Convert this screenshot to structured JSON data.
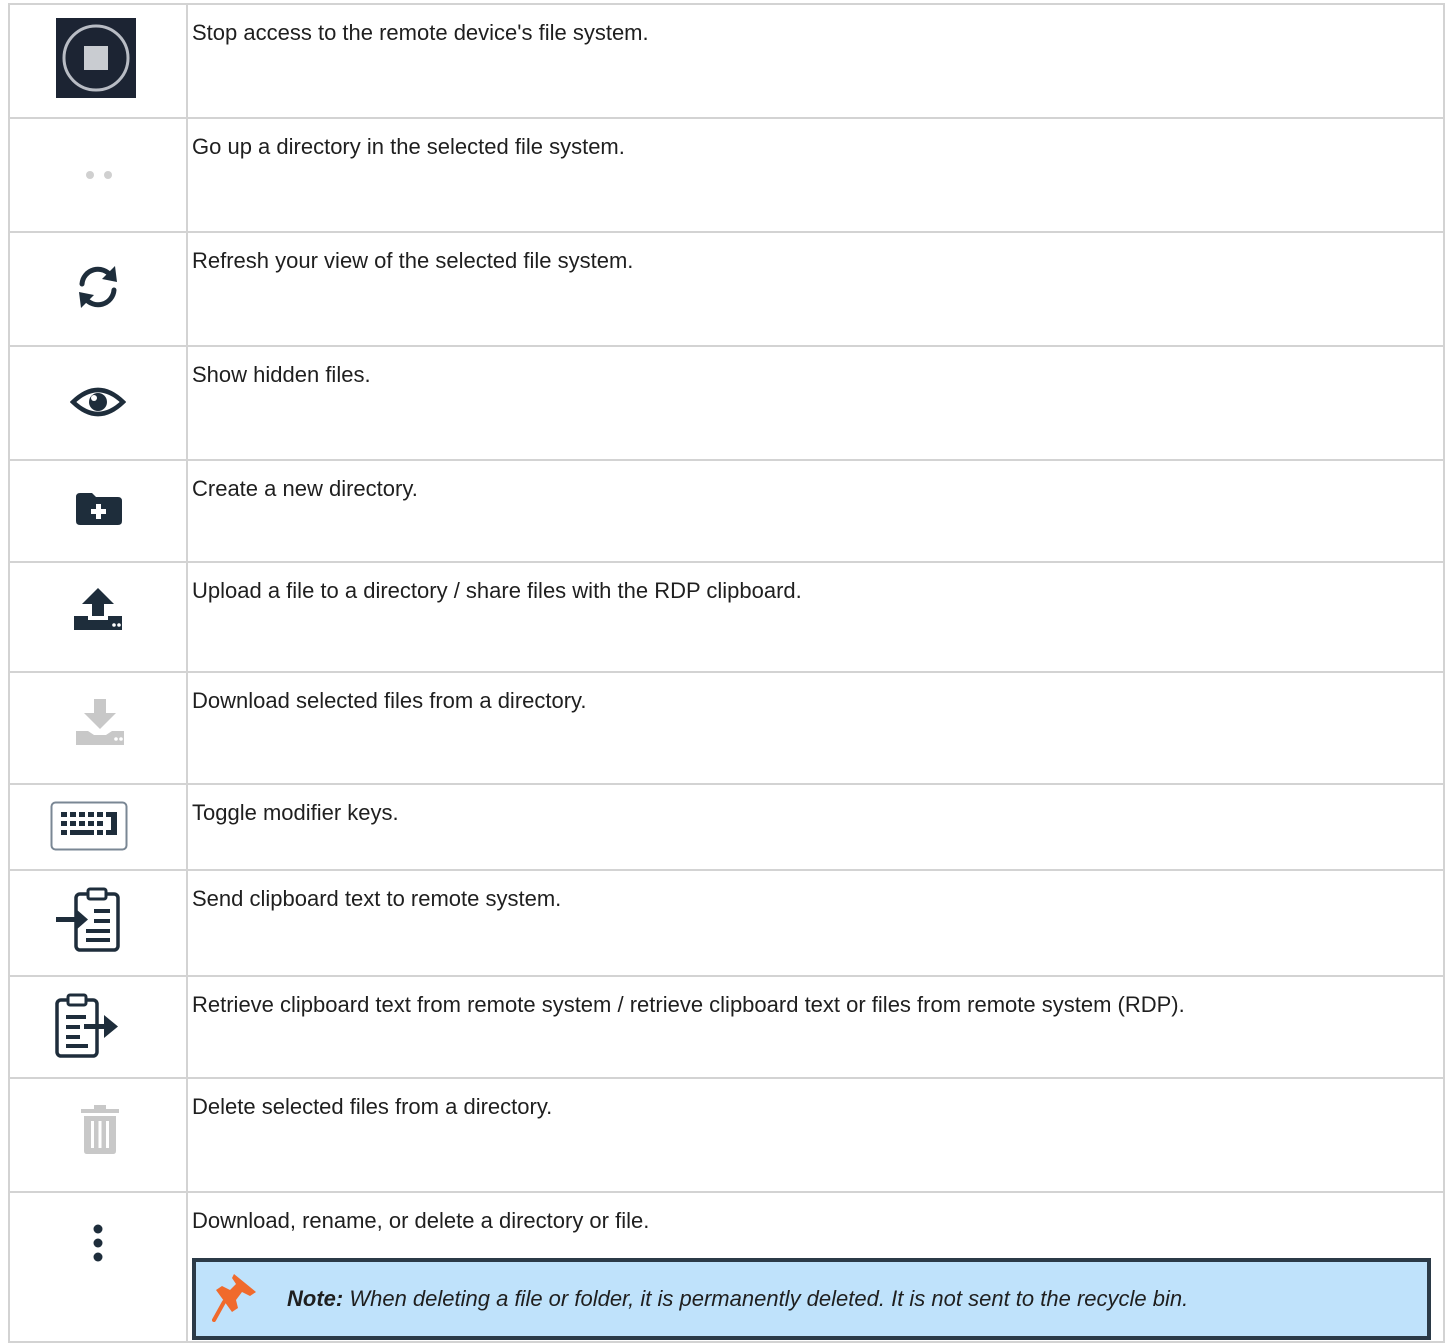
{
  "rows": [
    {
      "icon": "stop-icon",
      "description": "Stop access to the remote device's file system."
    },
    {
      "icon": "parent-directory-icon",
      "description": "Go up a directory in the selected file system."
    },
    {
      "icon": "refresh-icon",
      "description": "Refresh your view of the selected file system."
    },
    {
      "icon": "eye-icon",
      "description": "Show hidden files."
    },
    {
      "icon": "new-folder-icon",
      "description": "Create a new directory."
    },
    {
      "icon": "upload-icon",
      "description": "Upload a file to a directory / share files with the RDP clipboard."
    },
    {
      "icon": "download-icon",
      "description": "Download selected files from a directory."
    },
    {
      "icon": "keyboard-icon",
      "description": "Toggle modifier keys."
    },
    {
      "icon": "clipboard-send-icon",
      "description": "Send clipboard text to remote system."
    },
    {
      "icon": "clipboard-retrieve-icon",
      "description": "Retrieve clipboard text from remote system / retrieve clipboard text or files from remote system (RDP)."
    },
    {
      "icon": "trash-icon",
      "description": "Delete selected files from a directory."
    },
    {
      "icon": "more-vertical-icon",
      "description": "Download, rename, or delete a directory or file."
    }
  ],
  "note": {
    "icon": "pushpin-icon",
    "label": "Note:",
    "text": " When deleting a file or folder, it is permanently deleted. It is not sent to the recycle bin."
  },
  "colors": {
    "icon_dark": "#1e2d3b",
    "icon_disabled": "#c8c8c8",
    "stop_bg": "#1c2433",
    "note_bg": "#bfe2fb",
    "note_border": "#2b3a47",
    "pin": "#f06a2c"
  }
}
